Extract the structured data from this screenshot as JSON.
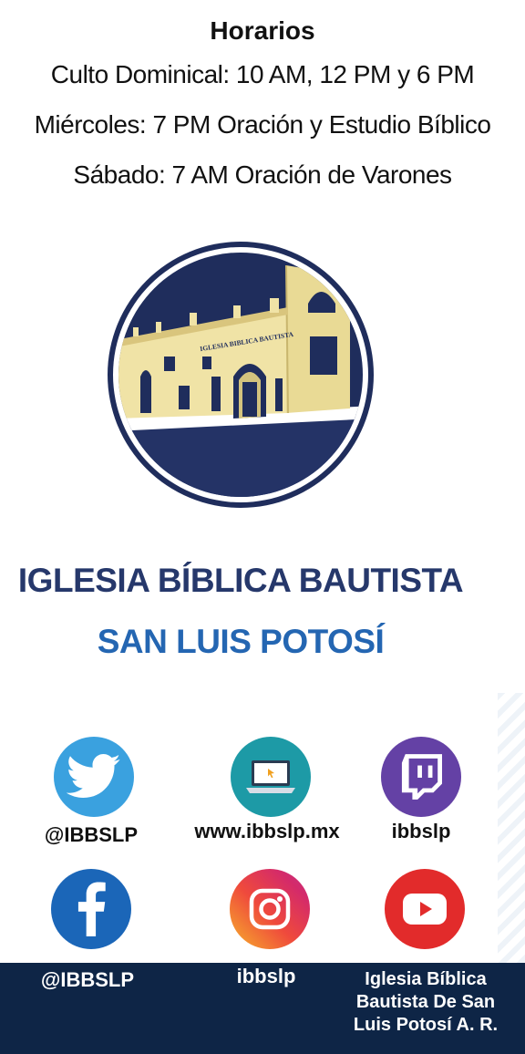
{
  "schedule": {
    "title": "Horarios",
    "lines": [
      "Culto Dominical: 10 AM, 12 PM y 6 PM",
      "Miércoles: 7 PM Oración y Estudio Bíblico",
      "Sábado: 7 AM Oración de Varones"
    ]
  },
  "logo": {
    "building_sign": "IGLESIA BIBLICA BAUTISTA",
    "ring_color": "#1f2d5c",
    "sky_color": "#1f2d5c",
    "building_color": "#f0e3a6"
  },
  "church": {
    "name": "IGLESIA BÍBLICA BAUTISTA",
    "city": "SAN LUIS POTOSÍ"
  },
  "social": {
    "twitter": {
      "icon": "twitter-icon",
      "label": "@IBBSLP",
      "color": "#3aa1df"
    },
    "website": {
      "icon": "laptop-icon",
      "label": "www.ibbslp.mx",
      "color": "#1d9aa6"
    },
    "twitch": {
      "icon": "twitch-icon",
      "label": "ibbslp",
      "color": "#6441a5"
    },
    "facebook": {
      "icon": "facebook-icon",
      "label": "@IBBSLP",
      "color": "#1b66b8"
    },
    "instagram": {
      "icon": "instagram-icon",
      "label": "ibbslp",
      "color": "#e8384f"
    },
    "youtube": {
      "icon": "youtube-icon",
      "label": "Iglesia Bíblica Bautista De San Luis Potosí A. R.",
      "label_lines": [
        "Iglesia Bíblica",
        "Bautista De San",
        "Luis Potosí A. R."
      ],
      "color": "#e22b2b"
    }
  },
  "colors": {
    "footer": "#0e2546",
    "title_dark": "#26386b",
    "title_blue": "#2466b2"
  }
}
